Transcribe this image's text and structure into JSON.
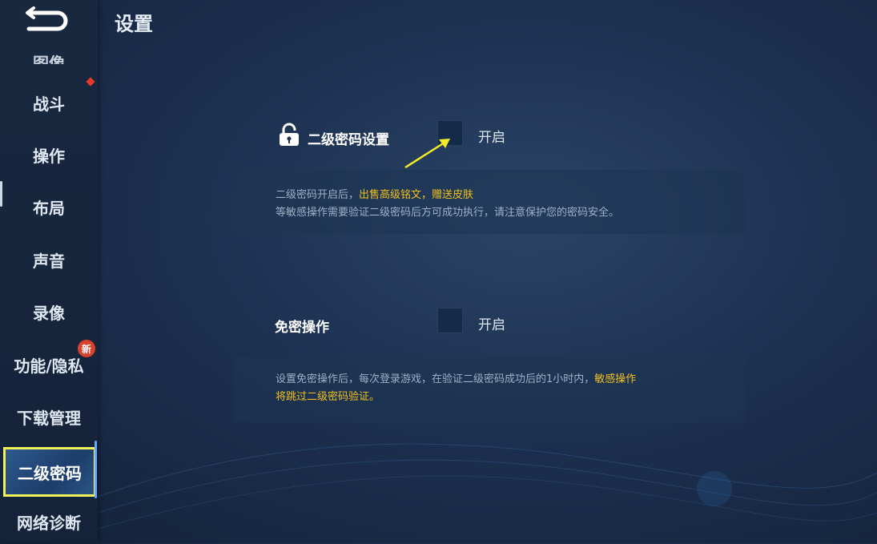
{
  "header": {
    "title": "设置"
  },
  "sidebar": {
    "items": [
      {
        "label": "图像"
      },
      {
        "label": "战斗"
      },
      {
        "label": "操作"
      },
      {
        "label": "布局"
      },
      {
        "label": "声音"
      },
      {
        "label": "录像"
      },
      {
        "label": "功能/隐私",
        "badge": "新"
      },
      {
        "label": "下载管理"
      },
      {
        "label": "二级密码",
        "active": true
      },
      {
        "label": "网络诊断"
      }
    ]
  },
  "main": {
    "password_setting": {
      "label": "二级密码设置",
      "toggle_label": "开启",
      "icon": "lock-icon",
      "desc_part1": "二级密码开启后，",
      "desc_highlight": "出售高级铭文，赠送皮肤",
      "desc_line2": "等敏感操作需要验证二级密码后方可成功执行，请注意保护您的密码安全。"
    },
    "free_operation": {
      "label": "免密操作",
      "toggle_label": "开启",
      "desc_part1": "设置免密操作后，每次登录游戏，在验证二级密码成功后的1小时内，",
      "desc_highlight": "敏感操作",
      "desc_line2": "将跳过二级密码验证。"
    }
  },
  "colors": {
    "highlight": "#f2c01e",
    "active_border": "#f1f15a",
    "badge_red": "#d8412c"
  }
}
